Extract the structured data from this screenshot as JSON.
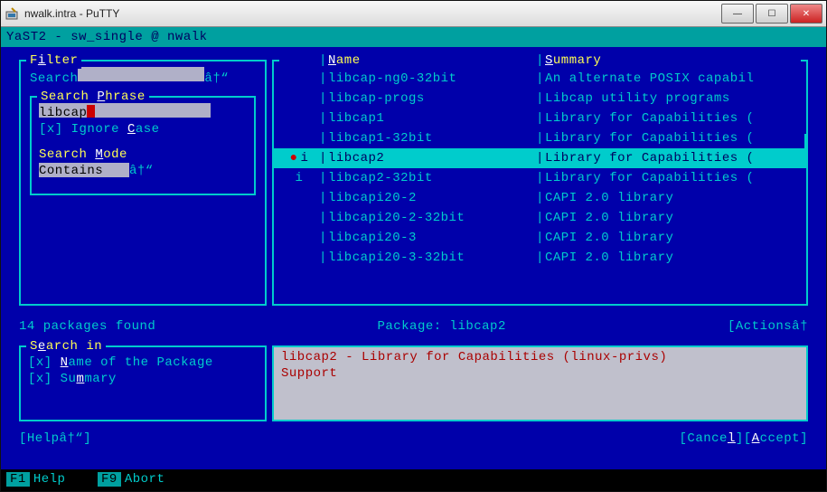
{
  "window": {
    "title": "nwalk.intra - PuTTY"
  },
  "header": "YaST2 - sw_single @ nwalk",
  "filter": {
    "label_pre": "F",
    "label_u": "i",
    "label_post": "lter",
    "search_label": "Search",
    "search_value": "",
    "dropdown_glyph": "â†“"
  },
  "search_phrase": {
    "label_pre": "Search ",
    "label_u": "P",
    "label_post": "hrase",
    "value": "libcap",
    "ignore_case": {
      "checked": "[x]",
      "label_pre": " Ignore ",
      "label_u": "C",
      "label_post": "ase"
    }
  },
  "search_mode": {
    "label_pre": "Search ",
    "label_u": "M",
    "label_post": "ode",
    "value": "Contains",
    "dropdown_glyph": "â†“"
  },
  "packages": {
    "name_header": "Name",
    "summary_header": "Summary",
    "rows": [
      {
        "status": "",
        "name": "libcap-ng0-32bit",
        "summary": "An alternate POSIX capabil",
        "selected": false
      },
      {
        "status": "",
        "name": "libcap-progs",
        "summary": "Libcap utility programs",
        "selected": false
      },
      {
        "status": "",
        "name": "libcap1",
        "summary": "Library for Capabilities (",
        "selected": false
      },
      {
        "status": "",
        "name": "libcap1-32bit",
        "summary": "Library for Capabilities (",
        "selected": false
      },
      {
        "status": "i",
        "name": "libcap2",
        "summary": "Library for Capabilities (",
        "selected": true
      },
      {
        "status": "i",
        "name": "libcap2-32bit",
        "summary": "Library for Capabilities (",
        "selected": false
      },
      {
        "status": "",
        "name": "libcapi20-2",
        "summary": "CAPI 2.0 library",
        "selected": false
      },
      {
        "status": "",
        "name": "libcapi20-2-32bit",
        "summary": "CAPI 2.0 library",
        "selected": false
      },
      {
        "status": "",
        "name": "libcapi20-3",
        "summary": "CAPI 2.0 library",
        "selected": false
      },
      {
        "status": "",
        "name": "libcapi20-3-32bit",
        "summary": "CAPI 2.0 library",
        "selected": false
      }
    ],
    "count_text": "14 packages found",
    "current": "Package: libcap2",
    "actions_label": "[Actionsâ†"
  },
  "search_in": {
    "label_pre": "S",
    "label_u": "e",
    "label_post": "arch in",
    "opts": [
      {
        "checked": "[x]",
        "pre": " ",
        "u": "N",
        "post": "ame of the Package"
      },
      {
        "checked": "[x]",
        "pre": " Su",
        "u": "m",
        "post": "mary"
      }
    ]
  },
  "description": {
    "line1": "libcap2 - Library for Capabilities (linux-privs)",
    "line2": "Support"
  },
  "buttons": {
    "help": "[Helpâ†“]",
    "cancel_pre": "[Cance",
    "cancel_u": "l",
    "cancel_post": "]",
    "accept_pre": "[",
    "accept_u": "A",
    "accept_post": "ccept]"
  },
  "footer": {
    "f1": "F1",
    "f1_label": "Help",
    "f9": "F9",
    "f9_label": "Abort"
  }
}
